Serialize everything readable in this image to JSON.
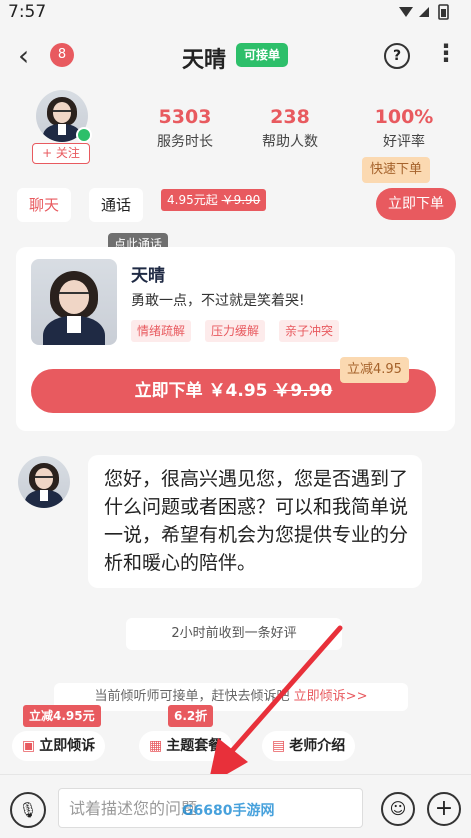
{
  "status_bar": {
    "time": "7:57"
  },
  "header": {
    "back": "‹",
    "unread": "8",
    "title": "天晴",
    "status_badge": "可接单",
    "help": "?",
    "more": "⋮"
  },
  "profile": {
    "follow": "+ 关注",
    "stats": [
      {
        "value": "5303",
        "label": "服务时长"
      },
      {
        "value": "238",
        "label": "帮助人数"
      },
      {
        "value": "100%",
        "label": "好评率"
      }
    ]
  },
  "tabs": {
    "chat": "聊天",
    "call": "通话",
    "price": "4.95元起",
    "old_price": "￥9.90",
    "call_tip": "点此通话",
    "fast_tip": "快速下单",
    "buy": "立即下单"
  },
  "card": {
    "name": "天晴",
    "motto": "勇敢一点，不过就是笑着哭!",
    "tags": [
      "情绪疏解",
      "压力缓解",
      "亲子冲突"
    ],
    "discount": "立减4.95",
    "buy_label": "立即下单 ￥4.95",
    "buy_old": "￥9.90"
  },
  "message": {
    "text": "您好，很高兴遇见您，您是否遇到了什么问题或者困惑？可以和我简单说一说，希望有机会为您提供专业的分析和暖心的陪伴。"
  },
  "notice": "2小时前收到一条好评",
  "hint": {
    "text": "当前倾听师可接单，赶快去倾诉吧",
    "link": "立即倾诉>>"
  },
  "quick": [
    {
      "tag": "立减4.95元",
      "label": "立即倾诉"
    },
    {
      "tag": "6.2折",
      "label": "主题套餐"
    },
    {
      "tag": "",
      "label": "老师介绍"
    }
  ],
  "input": {
    "placeholder": "试着描述您的问题"
  },
  "watermark": "G6680手游网",
  "colors": {
    "accent": "#e85a5f",
    "green": "#2dbf6a",
    "tip": "#fbd9b1"
  }
}
